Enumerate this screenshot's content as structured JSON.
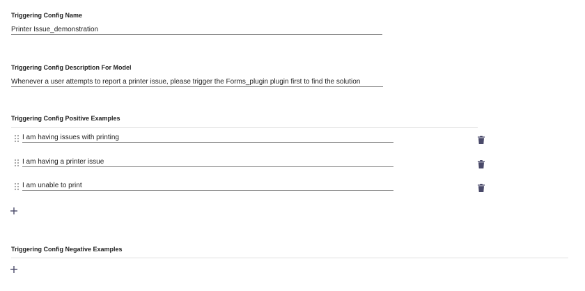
{
  "config_name": {
    "label": "Triggering Config Name",
    "value": "Printer Issue_demonstration"
  },
  "config_description": {
    "label": "Triggering Config Description For Model",
    "value": "Whenever a user attempts to report a printer issue, please trigger the Forms_plugin plugin first to find the solution"
  },
  "positive_examples": {
    "label": "Triggering Config Positive Examples",
    "items": [
      "I am having issues with printing",
      "I am having a printer issue",
      "I am unable to print"
    ],
    "add_icon": "plus-icon",
    "delete_icon": "trash-icon",
    "drag_icon": "drag-handle-icon"
  },
  "negative_examples": {
    "label": "Triggering Config Negative Examples",
    "add_icon": "plus-icon"
  },
  "colors": {
    "icon": "#4a4a6a",
    "text": "#212121",
    "underline": "#8a8a8a",
    "rule": "#e0e0e0"
  }
}
